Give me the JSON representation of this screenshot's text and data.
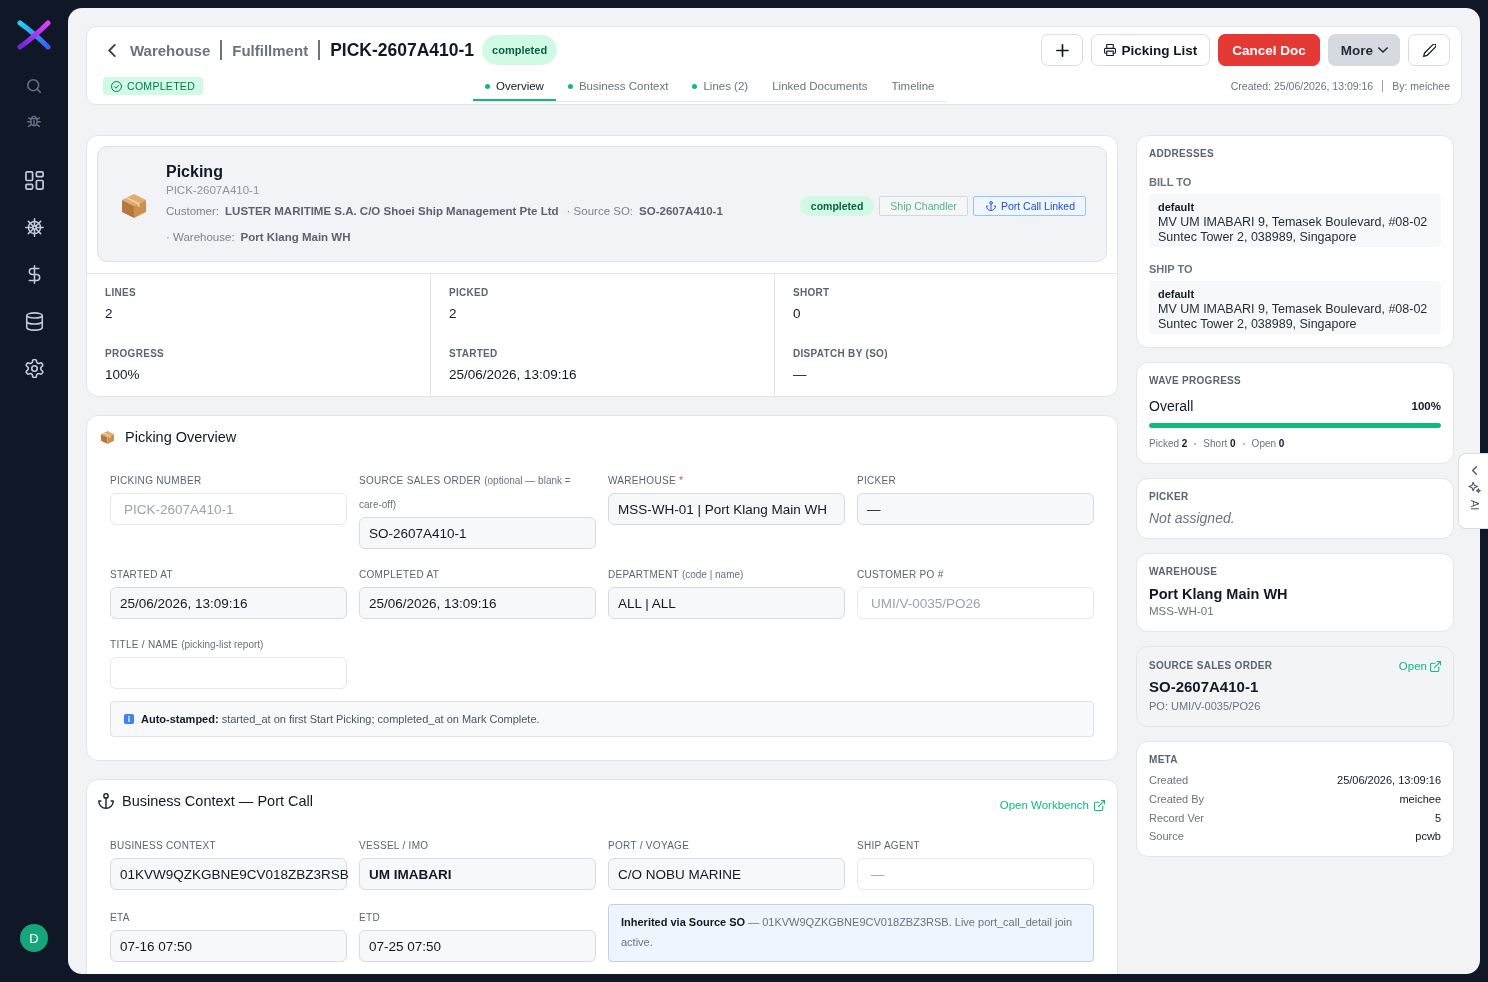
{
  "sidebar": {
    "avatar": "D"
  },
  "header": {
    "breadcrumbs": [
      "Warehouse",
      "Fulfillment"
    ],
    "title": "PICK-2607A410-1",
    "status_pill": "completed",
    "buttons": [
      {
        "kind": "add"
      },
      {
        "kind": "print",
        "label": "Picking List"
      },
      {
        "kind": "danger",
        "label": "Cancel Doc"
      },
      {
        "kind": "dropdown",
        "label": "More"
      },
      {
        "kind": "edit"
      }
    ],
    "status_badge": "COMPLETED",
    "tabs": [
      {
        "label": "Overview",
        "selected": true,
        "dot": true
      },
      {
        "label": "Business Context",
        "selected": false,
        "dot": true
      },
      {
        "label": "Lines (2)",
        "selected": false,
        "dot": true
      },
      {
        "label": "Linked Documents",
        "selected": false,
        "dot": false
      },
      {
        "label": "Timeline",
        "selected": false,
        "dot": false
      }
    ],
    "created": "Created: 25/06/2026, 13:09:16",
    "created_by": "By: meichee"
  },
  "summary": {
    "title": "Picking",
    "subtitle": "PICK-2607A410-1",
    "details": [
      {
        "label": "Customer:",
        "value": "LUSTER MARITIME S.A. C/O Shoei Ship Management Pte Ltd"
      },
      {
        "label": "· Source SO:",
        "value": "SO-2607A410-1"
      },
      {
        "label": "· Warehouse:",
        "value": "Port Klang Main WH"
      }
    ],
    "tags": [
      {
        "kind": "status",
        "label": "completed"
      },
      {
        "kind": "category",
        "label": "Ship Chandler"
      },
      {
        "kind": "link",
        "label": "Port Call Linked"
      }
    ]
  },
  "stats": [
    {
      "label": "LINES",
      "value": "2"
    },
    {
      "label": "PICKED",
      "value": "2"
    },
    {
      "label": "SHORT",
      "value": "0"
    },
    {
      "label": "PROGRESS",
      "value": "100%"
    },
    {
      "label": "STARTED",
      "value": "25/06/2026, 13:09:16"
    },
    {
      "label": "DISPATCH BY (SO)",
      "value": "—"
    }
  ],
  "picking_overview": {
    "title": "Picking Overview",
    "fields": [
      {
        "label": "PICKING NUMBER",
        "placeholder": "PICK-2607A410-1"
      },
      {
        "label": "SOURCE SALES ORDER",
        "hint": "(optional — blank = care-off)",
        "value": "SO-2607A410-1"
      },
      {
        "label": "WAREHOUSE",
        "required_mark": "*",
        "value": "MSS-WH-01 | Port Klang Main WH"
      },
      {
        "label": "PICKER",
        "value": "—"
      },
      {
        "label": "STARTED AT",
        "value": "25/06/2026, 13:09:16"
      },
      {
        "label": "COMPLETED AT",
        "value": "25/06/2026, 13:09:16"
      },
      {
        "label": "DEPARTMENT",
        "hint": "(code | name)",
        "value": "ALL | ALL"
      },
      {
        "label": "CUSTOMER PO #",
        "placeholder": "UMI/V-0035/PO26"
      },
      {
        "label": "TITLE / NAME",
        "hint": "(picking-list report)"
      }
    ],
    "note": "**Auto-stamped:** started_at on first Start Picking; completed_at on Mark Complete."
  },
  "business_context": {
    "title": "Business Context — Port Call",
    "link": "Open Workbench",
    "fields": [
      {
        "label": "BUSINESS CONTEXT",
        "value": "01KVW9QZKGBNE9CV018ZBZ3RSB",
        "bold": false
      },
      {
        "label": "VESSEL / IMO",
        "value": "UM IMABARI",
        "bold": true
      },
      {
        "label": "PORT / VOYAGE",
        "value": "C/O NOBU MARINE",
        "bold": false
      },
      {
        "label": "SHIP AGENT",
        "placeholder": "—",
        "bold": false
      },
      {
        "label": "ETA",
        "value": "07-16 07:50",
        "bold": false
      },
      {
        "label": "ETD",
        "value": "07-25 07:50",
        "bold": false
      }
    ],
    "note": "**Inherited via Source SO** — 01KVW9QZKGBNE9CV018ZBZ3RSB. Live port_call_detail join active."
  },
  "addresses": {
    "title": "ADDRESSES",
    "blocks": [
      {
        "label": "BILL TO",
        "name": "default",
        "lines": [
          "MV UM IMABARI 9, Temasek Boulevard, #08-02",
          "Suntec Tower 2, 038989, Singapore"
        ]
      },
      {
        "label": "SHIP TO",
        "name": "default",
        "lines": [
          "MV UM IMABARI 9, Temasek Boulevard, #08-02",
          "Suntec Tower 2, 038989, Singapore"
        ]
      }
    ]
  },
  "wave_progress": {
    "title": "WAVE PROGRESS",
    "label": "Overall",
    "reading": "100%",
    "level": 1.0,
    "counts": [
      {
        "label": "Picked",
        "value": "2"
      },
      {
        "label": "Short",
        "value": "0"
      },
      {
        "label": "Open",
        "value": "0"
      }
    ]
  },
  "picker": {
    "title": "PICKER",
    "value": "Not assigned."
  },
  "warehouse": {
    "title": "WAREHOUSE",
    "name": "Port Klang Main WH",
    "code": "MSS-WH-01"
  },
  "source_sales_order": {
    "title": "SOURCE SALES ORDER",
    "link": "Open",
    "number": "SO-2607A410-1",
    "po": "PO: UMI/V-0035/PO26"
  },
  "meta": {
    "title": "META",
    "rows": [
      {
        "label": "Created",
        "value": "25/06/2026, 13:09:16"
      },
      {
        "label": "Created By",
        "value": "meichee"
      },
      {
        "label": "Record Ver",
        "value": "5"
      },
      {
        "label": "Source",
        "value": "pcwb"
      }
    ]
  },
  "ai_tab": {
    "label": "AI"
  }
}
